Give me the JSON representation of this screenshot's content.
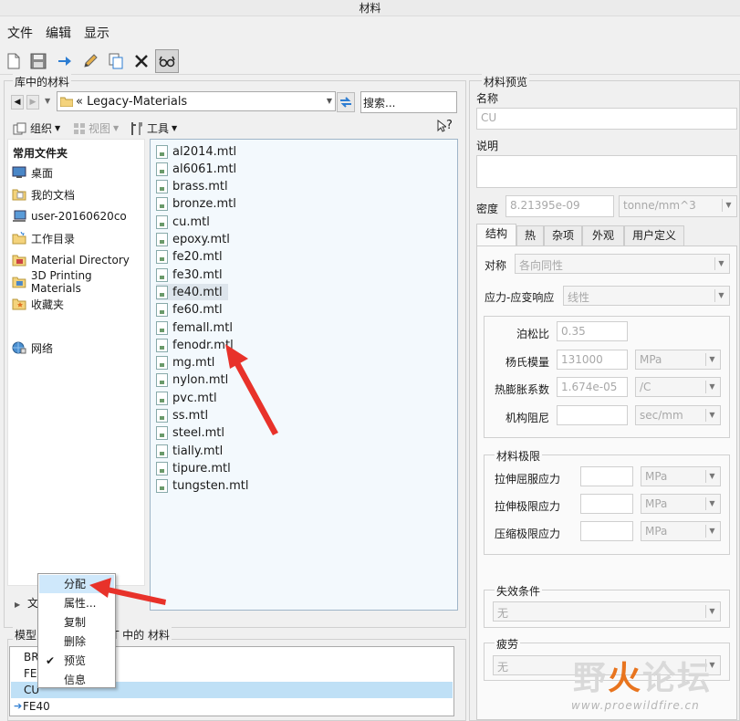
{
  "window": {
    "title": "材料"
  },
  "menu": [
    "文件",
    "编辑",
    "显示"
  ],
  "library": {
    "title": "库中的材料",
    "path": "« Legacy-Materials",
    "search_placeholder": "搜索...",
    "organize": "组织",
    "view": "视图",
    "tools": "工具",
    "help_symbol": "?",
    "favorites_header": "常用文件夹",
    "favorites": [
      "桌面",
      "我的文档",
      "user-20160620co",
      "工作目录",
      "Material Directory",
      "3D Printing Materials",
      "收藏夹",
      "网络"
    ],
    "files": [
      "al2014.mtl",
      "al6061.mtl",
      "brass.mtl",
      "bronze.mtl",
      "cu.mtl",
      "epoxy.mtl",
      "fe20.mtl",
      "fe30.mtl",
      "fe40.mtl",
      "fe60.mtl",
      "femall.mtl",
      "fenodr.mtl",
      "mg.mtl",
      "nylon.mtl",
      "pvc.mtl",
      "ss.mtl",
      "steel.mtl",
      "tially.mtl",
      "tipure.mtl",
      "tungsten.mtl"
    ],
    "highlighted_file": "fe40.mtl",
    "folder_tree_label": "文"
  },
  "context_menu": {
    "items": [
      "分配",
      "属性...",
      "复制",
      "删除",
      "预览",
      "信息"
    ],
    "selected": "分配",
    "checked": "预览"
  },
  "model": {
    "title_prefix": "模型",
    "title_suffix": "T 中的 材料",
    "rows": [
      "BR",
      "FE",
      "CU",
      "FE40"
    ],
    "selected_row": "CU",
    "active_row": "FE40"
  },
  "preview": {
    "title": "材料预览",
    "name_label": "名称",
    "name_value": "CU",
    "desc_label": "说明",
    "density_label": "密度",
    "density_value": "8.21395e-09",
    "density_unit": "tonne/mm^3",
    "tabs": [
      "结构",
      "热",
      "杂项",
      "外观",
      "用户定义"
    ],
    "active_tab": "结构",
    "symmetry_label": "对称",
    "symmetry_value": "各向同性",
    "stress_label": "应力-应变响应",
    "stress_value": "线性",
    "poisson_label": "泊松比",
    "poisson_value": "0.35",
    "young_label": "杨氏模量",
    "young_value": "131000",
    "young_unit": "MPa",
    "thermal_label": "热膨胀系数",
    "thermal_value": "1.674e-05",
    "thermal_unit": "/C",
    "damping_label": "机构阻尼",
    "damping_unit": "sec/mm",
    "limits_title": "材料极限",
    "tensile_yield_label": "拉伸屈服应力",
    "tensile_ultimate_label": "拉伸极限应力",
    "compress_ultimate_label": "压缩极限应力",
    "limit_unit": "MPa",
    "failure_title": "失效条件",
    "failure_value": "无",
    "fatigue_title": "疲劳",
    "fatigue_value": "无"
  },
  "watermark": {
    "text_a": "野",
    "text_b": "火",
    "text_c": "论坛",
    "url": "www.proewildfire.cn"
  },
  "colors": {
    "selection": "#cfe8fb",
    "list_selection": "#bfe0f6",
    "arrow": "#e8322a"
  }
}
